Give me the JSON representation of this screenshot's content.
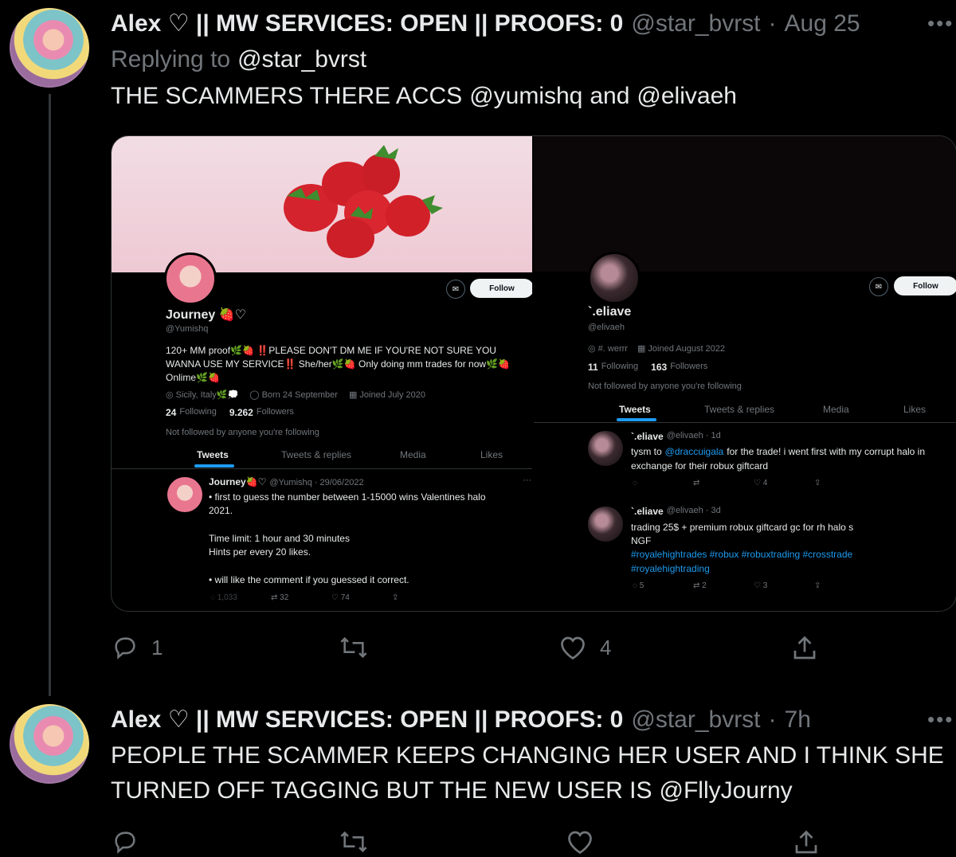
{
  "tweet1": {
    "name": "Alex ♡ || MW SERVICES: OPEN || PROOFS: 0",
    "handle": "@star_bvrst",
    "sep": "·",
    "time": "Aug 25",
    "replying_prefix": "Replying to",
    "replying_handle": "@star_bvrst",
    "text_before": "THE SCAMMERS THERE ACCS",
    "mention1": "@yumishq",
    "and_text": "and",
    "mention2": "@elivaeh",
    "reply_count": "1",
    "like_count": "4"
  },
  "left_profile": {
    "display_name": "Journey",
    "handle": "@Yumishq",
    "follow_label": "Follow",
    "bio_line1": "120+ MM proof🌿🍓 ‼️PLEASE DON'T DM ME IF YOU'RE NOT SURE YOU",
    "bio_line2": "WANNA USE MY SERVICE‼️ She/her🌿🍓 Only doing mm trades for now🌿🍓",
    "bio_line3": "Onlime🌿🍓",
    "location": "Sicily, Italy🌿💭",
    "born": "Born 24 September",
    "joined": "Joined July 2020",
    "following_count": "24",
    "following_label": "Following",
    "followers_count": "9.262",
    "followers_label": "Followers",
    "not_followed": "Not followed by anyone you're following",
    "tabs": [
      "Tweets",
      "Tweets & replies",
      "Media",
      "Likes"
    ],
    "post": {
      "name": "Journey🍓♡",
      "meta": "@Yumishq · 29/06/2022",
      "line1": "• first to guess the number between 1-15000 wins Valentines halo",
      "line2": "2021.",
      "line3": "Time limit: 1 hour and 30 minutes",
      "line4": "Hints per every 20 likes.",
      "line5": "• will like the comment if you guessed it correct.",
      "replies": "1,033",
      "retweets": "32",
      "likes": "74"
    }
  },
  "right_profile": {
    "display_name": "`.eliave",
    "handle": "@elivaeh",
    "follow_label": "Follow",
    "location": "#. werrr",
    "joined": "Joined August 2022",
    "following_count": "11",
    "following_label": "Following",
    "followers_count": "163",
    "followers_label": "Followers",
    "not_followed": "Not followed by anyone you're following",
    "tabs": [
      "Tweets",
      "Tweets & replies",
      "Media",
      "Likes"
    ],
    "post1": {
      "name": "`.eliave",
      "meta": "@elivaeh · 1d",
      "line1_pre": "tysm to",
      "line1_mention": "@draccuigala",
      "line1_post": "for the trade! i went first with my corrupt halo in",
      "line2": "exchange for their robux giftcard",
      "likes": "4"
    },
    "post2": {
      "name": "`.eliave",
      "meta": "@elivaeh · 3d",
      "line1": "trading 25$ + premium robux giftcard gc for rh halo s",
      "line2": "NGF",
      "line3": "#royalehightrades #robux #robuxtrading #crosstrade",
      "line4": "#royalehightrading",
      "replies": "5",
      "retweets": "2",
      "likes": "3"
    }
  },
  "tweet2": {
    "name": "Alex ♡ || MW SERVICES: OPEN || PROOFS: 0",
    "handle": "@star_bvrst",
    "sep": "·",
    "time": "7h",
    "line1": "PEOPLE THE SCAMMER KEEPS CHANGING HER USER AND I THINK SHE",
    "line2_pre": "TURNED OFF TAGGING BUT THE NEW USER IS",
    "line2_mention": "@FllyJourny"
  },
  "icons": {
    "more": "more-dots-icon",
    "reply": "reply-icon",
    "retweet": "retweet-icon",
    "like": "heart-icon",
    "share": "share-icon"
  },
  "colors": {
    "background": "#000000",
    "text": "#e7e9ea",
    "muted": "#71767b",
    "link": "#1d9bf0"
  }
}
